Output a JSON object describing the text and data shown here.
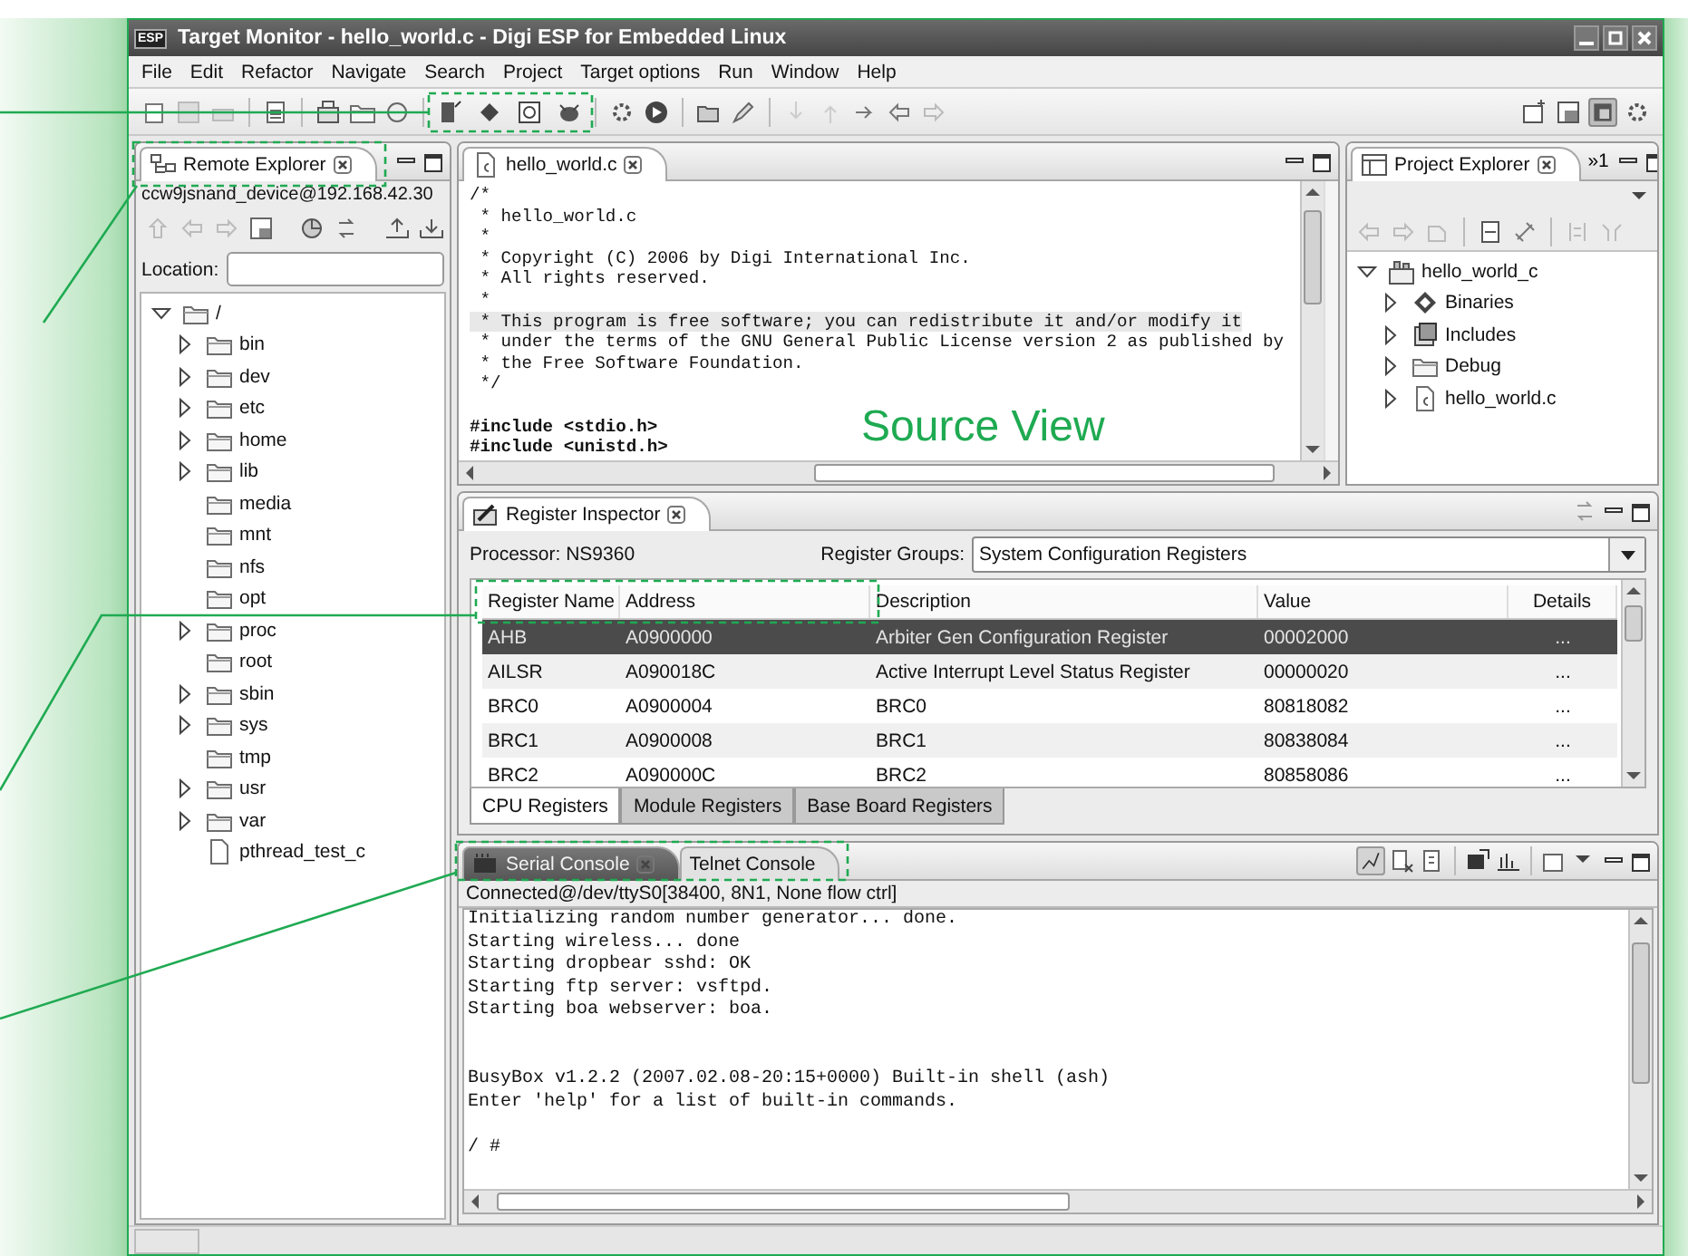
{
  "window": {
    "icon_label": "ESP",
    "title": "Target Monitor - hello_world.c - Digi ESP for Embedded Linux"
  },
  "menu": [
    "File",
    "Edit",
    "Refactor",
    "Navigate",
    "Search",
    "Project",
    "Target options",
    "Run",
    "Window",
    "Help"
  ],
  "remote_explorer": {
    "tab": {
      "label": "Remote Explorer",
      "selected": true
    },
    "connection": "ccw9jsnand_device@192.168.42.30",
    "location_label": "Location:",
    "tree": {
      "label": "/",
      "kind": "folder",
      "expandable": true,
      "expanded": true,
      "children": [
        {
          "label": "bin",
          "kind": "folder",
          "expandable": true,
          "expanded": false
        },
        {
          "label": "dev",
          "kind": "folder",
          "expandable": true,
          "expanded": false
        },
        {
          "label": "etc",
          "kind": "folder",
          "expandable": true,
          "expanded": false
        },
        {
          "label": "home",
          "kind": "folder",
          "expandable": true,
          "expanded": false
        },
        {
          "label": "lib",
          "kind": "folder",
          "expandable": true,
          "expanded": false
        },
        {
          "label": "media",
          "kind": "folder",
          "expandable": false,
          "expanded": false
        },
        {
          "label": "mnt",
          "kind": "folder",
          "expandable": false,
          "expanded": false
        },
        {
          "label": "nfs",
          "kind": "folder",
          "expandable": false,
          "expanded": false
        },
        {
          "label": "opt",
          "kind": "folder",
          "expandable": false,
          "expanded": false
        },
        {
          "label": "proc",
          "kind": "folder",
          "expandable": true,
          "expanded": false
        },
        {
          "label": "root",
          "kind": "folder",
          "expandable": false,
          "expanded": false
        },
        {
          "label": "sbin",
          "kind": "folder",
          "expandable": true,
          "expanded": false
        },
        {
          "label": "sys",
          "kind": "folder",
          "expandable": true,
          "expanded": false
        },
        {
          "label": "tmp",
          "kind": "folder",
          "expandable": false,
          "expanded": false
        },
        {
          "label": "usr",
          "kind": "folder",
          "expandable": true,
          "expanded": false
        },
        {
          "label": "var",
          "kind": "folder",
          "expandable": true,
          "expanded": false
        },
        {
          "label": "pthread_test_c",
          "kind": "file",
          "expandable": false,
          "expanded": false
        }
      ]
    }
  },
  "editor": {
    "tab": {
      "label": "hello_world.c",
      "selected": true
    },
    "lines": [
      {
        "text": "/*",
        "kind": "comment",
        "current": false
      },
      {
        "text": " * hello_world.c",
        "kind": "comment",
        "current": false
      },
      {
        "text": " *",
        "kind": "comment",
        "current": false
      },
      {
        "text": " * Copyright (C) 2006 by Digi International Inc.",
        "kind": "comment",
        "current": false
      },
      {
        "text": " * All rights reserved.",
        "kind": "comment",
        "current": false
      },
      {
        "text": " *",
        "kind": "comment",
        "current": false
      },
      {
        "text": " * This program is free software; you can redistribute it and/or modify it",
        "kind": "comment",
        "current": true
      },
      {
        "text": " * under the terms of the GNU General Public License version 2 as published by",
        "kind": "comment",
        "current": false
      },
      {
        "text": " * the Free Software Foundation.",
        "kind": "comment",
        "current": false
      },
      {
        "text": " */",
        "kind": "comment",
        "current": false
      },
      {
        "text": "#include <stdio.h>",
        "kind": "directive",
        "current": false
      },
      {
        "text": "#include <unistd.h>",
        "kind": "directive",
        "current": false
      }
    ],
    "callout_label": "Source View"
  },
  "project_explorer": {
    "tab": {
      "label": "Project Explorer",
      "selected": true
    },
    "overflow": "»1",
    "tree": {
      "label": "hello_world_c",
      "kind": "project",
      "expandable": true,
      "expanded": true,
      "children": [
        {
          "label": "Binaries",
          "kind": "binaries",
          "expandable": true,
          "expanded": false
        },
        {
          "label": "Includes",
          "kind": "includes",
          "expandable": true,
          "expanded": false
        },
        {
          "label": "Debug",
          "kind": "folder",
          "expandable": true,
          "expanded": false
        },
        {
          "label": "hello_world.c",
          "kind": "c-file",
          "expandable": true,
          "expanded": false
        }
      ]
    }
  },
  "register_inspector": {
    "tab": {
      "label": "Register Inspector",
      "selected": true
    },
    "processor": "Processor: NS9360",
    "groups_label": "Register Groups:",
    "groups_value": "System Configuration Registers",
    "columns": [
      "Register Name",
      "Address",
      "Description",
      "Value",
      "Details"
    ],
    "rows": [
      {
        "cells": [
          "AHB",
          "A0900000",
          "Arbiter Gen Configuration Register",
          "00002000",
          "..."
        ],
        "selected": true
      },
      {
        "cells": [
          "AILSR",
          "A090018C",
          "Active Interrupt Level Status Register",
          "00000020",
          "..."
        ],
        "selected": false
      },
      {
        "cells": [
          "BRC0",
          "A0900004",
          "BRC0",
          "80818082",
          "..."
        ],
        "selected": false
      },
      {
        "cells": [
          "BRC1",
          "A0900008",
          "BRC1",
          "80838084",
          "..."
        ],
        "selected": false
      },
      {
        "cells": [
          "BRC2",
          "A090000C",
          "BRC2",
          "80858086",
          "..."
        ],
        "selected": false
      }
    ],
    "bottom_tabs": [
      {
        "label": "CPU Registers",
        "selected": true
      },
      {
        "label": "Module Registers",
        "selected": false
      },
      {
        "label": "Base Board Registers",
        "selected": false
      }
    ]
  },
  "console": {
    "tabs": [
      {
        "label": "Serial Console",
        "selected": true,
        "closable": true
      },
      {
        "label": "Telnet Console",
        "selected": false,
        "closable": false
      }
    ],
    "status": "Connected@/dev/ttyS0[38400, 8N1, None flow ctrl]",
    "output": "Initializing random number generator... done.\nStarting wireless... done\nStarting dropbear sshd: OK\nStarting ftp server: vsftpd.\nStarting boa webserver: boa.\n\n\nBusyBox v1.2.2 (2007.02.08-20:15+0000) Built-in shell (ash)\nEnter 'help' for a list of built-in commands.\n\n/ #"
  }
}
